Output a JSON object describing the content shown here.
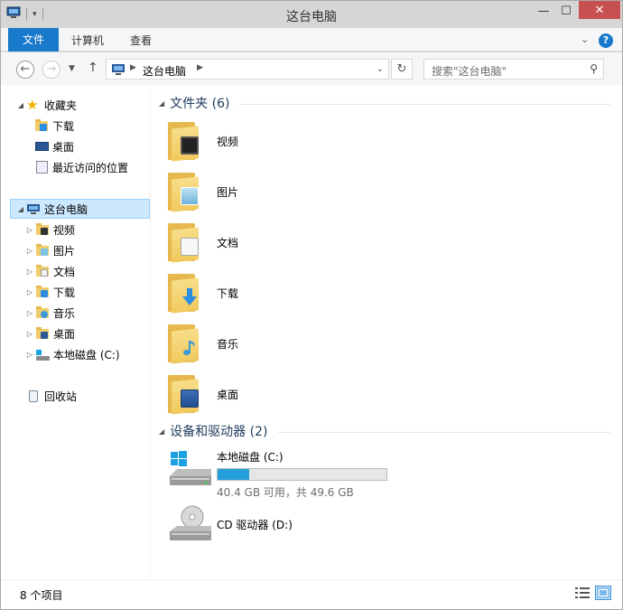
{
  "window": {
    "title": "这台电脑"
  },
  "title_buttons": {
    "minimize": "—",
    "maximize": "☐",
    "close": "✕"
  },
  "ribbon": {
    "file_tab": "文件",
    "tabs": [
      "计算机",
      "查看"
    ],
    "help": "?"
  },
  "nav": {
    "address_crumb": "这台电脑",
    "search_placeholder": "搜索\"这台电脑\""
  },
  "sidebar": {
    "favorites_label": "收藏夹",
    "favorites": [
      "下载",
      "桌面",
      "最近访问的位置"
    ],
    "this_pc_label": "这台电脑",
    "this_pc_children": [
      "视频",
      "图片",
      "文档",
      "下载",
      "音乐",
      "桌面",
      "本地磁盘 (C:)"
    ],
    "recycle_bin": "回收站"
  },
  "groups": {
    "folders_header": "文件夹 (6)",
    "devices_header": "设备和驱动器 (2)"
  },
  "folders": [
    {
      "name": "视频",
      "icon": "video-folder-icon"
    },
    {
      "name": "图片",
      "icon": "pictures-folder-icon"
    },
    {
      "name": "文档",
      "icon": "documents-folder-icon"
    },
    {
      "name": "下载",
      "icon": "downloads-folder-icon"
    },
    {
      "name": "音乐",
      "icon": "music-folder-icon"
    },
    {
      "name": "桌面",
      "icon": "desktop-folder-icon"
    }
  ],
  "drives": [
    {
      "name": "本地磁盘 (C:)",
      "free_text": "40.4 GB 可用，共 49.6 GB",
      "used_fraction": 0.186
    },
    {
      "name": "CD 驱动器 (D:)"
    }
  ],
  "status": {
    "items_count": "8 个项目"
  },
  "colors": {
    "accent": "#1979ca",
    "selection": "#cce8ff",
    "drive_fill": "#26a0da",
    "close_button": "#c75050"
  }
}
